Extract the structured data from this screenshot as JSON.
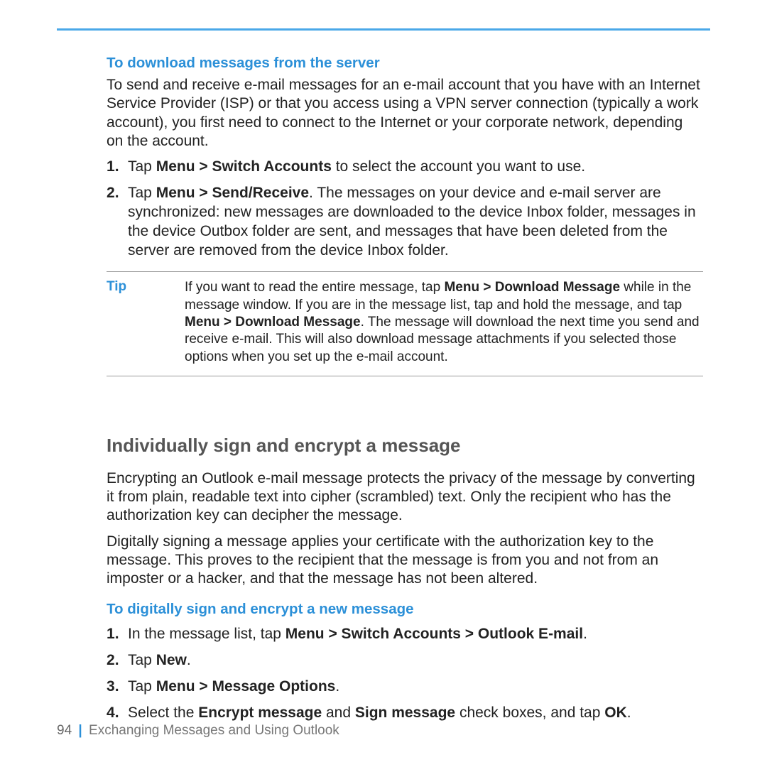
{
  "section1": {
    "heading": "To download messages from the server",
    "intro": "To send and receive e-mail messages for an e-mail account that you have with an Internet Service Provider (ISP) or that you access using a VPN server connection (typically a work account), you first need to connect to the Internet or your corporate network, depending on the account.",
    "step1": {
      "prefix": "Tap ",
      "bold": "Menu > Switch Accounts",
      "suffix": " to select the account you want to use."
    },
    "step2": {
      "prefix": "Tap ",
      "bold": "Menu > Send/Receive",
      "suffix": ". The messages on your device and e-mail server are synchronized: new messages are downloaded to the device Inbox folder, messages in the device Outbox folder are sent, and messages that have been deleted from the server are removed from the device Inbox folder."
    },
    "tip": {
      "label": "Tip",
      "t1": "If you want to read the entire message, tap ",
      "b1": "Menu > Download Message",
      "t2": " while in the message window. If you are in the message list, tap and hold the message, and tap ",
      "b2": "Menu > Download Message",
      "t3": ". The message will download the next time you send and receive e-mail. This will also download message attachments if you selected those options when you set up the e-mail account."
    }
  },
  "section2": {
    "heading": "Individually sign and encrypt a message",
    "para1": "Encrypting an Outlook e-mail message protects the privacy of the message by converting it from plain, readable text into cipher (scrambled) text. Only the recipient who has the authorization key can decipher the message.",
    "para2": "Digitally signing a message applies your certificate with the authorization key to the message. This proves to the recipient that the message is from you and not from an imposter or a hacker, and that the message has not been altered.",
    "subheading": "To digitally sign and encrypt a new message",
    "step1": {
      "prefix": "In the message list, tap ",
      "bold": "Menu > Switch Accounts > Outlook E-mail",
      "suffix": "."
    },
    "step2": {
      "prefix": "Tap ",
      "bold": "New",
      "suffix": "."
    },
    "step3": {
      "prefix": "Tap ",
      "bold": "Menu > Message Options",
      "suffix": "."
    },
    "step4": {
      "p1": "Select the ",
      "b1": "Encrypt message",
      "p2": " and ",
      "b2": "Sign message",
      "p3": " check boxes, and tap ",
      "b3": "OK",
      "p4": "."
    }
  },
  "footer": {
    "page": "94",
    "divider": "|",
    "chapter": "Exchanging Messages and Using Outlook"
  }
}
